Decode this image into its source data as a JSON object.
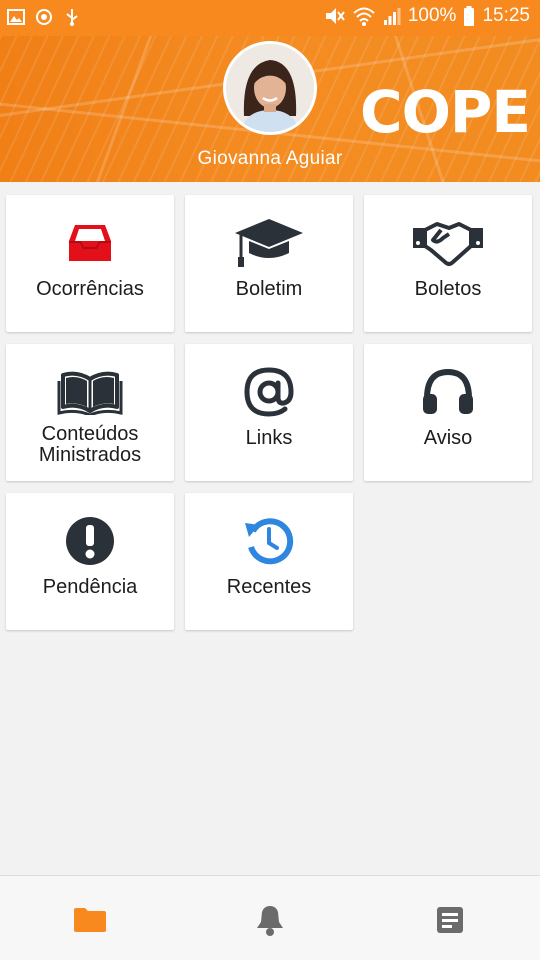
{
  "status_bar": {
    "battery": "100%",
    "time": "15:25"
  },
  "header": {
    "user_name": "Giovanna Aguiar",
    "brand": "COPE"
  },
  "menu": [
    {
      "label": "Ocorrências",
      "icon": "inbox-icon",
      "color": "#e3101a"
    },
    {
      "label": "Boletim",
      "icon": "graduation-cap-icon",
      "color": "#2b3138"
    },
    {
      "label": "Boletos",
      "icon": "handshake-icon",
      "color": "#2b3138"
    },
    {
      "label": "Conteúdos Ministrados",
      "icon": "open-book-icon",
      "color": "#2b3138"
    },
    {
      "label": "Links",
      "icon": "at-sign-icon",
      "color": "#2b3138"
    },
    {
      "label": "Aviso",
      "icon": "headphones-icon",
      "color": "#2b3138"
    },
    {
      "label": "Pendência",
      "icon": "exclamation-circle-icon",
      "color": "#2b3138"
    },
    {
      "label": "Recentes",
      "icon": "history-icon",
      "color": "#2f86de"
    }
  ],
  "bottom_nav": [
    {
      "icon": "folder-icon",
      "active": true,
      "color": "#f7891f"
    },
    {
      "icon": "bell-icon",
      "active": false,
      "color": "#6b6b6b"
    },
    {
      "icon": "document-icon",
      "active": false,
      "color": "#6b6b6b"
    }
  ]
}
